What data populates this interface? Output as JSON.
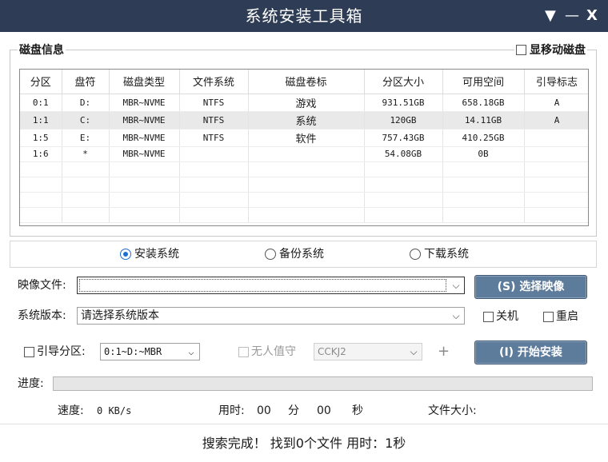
{
  "window": {
    "title": "系统安装工具箱",
    "menu_glyph": "▼",
    "minimize_glyph": "—",
    "close_glyph": "X"
  },
  "disk_group": {
    "title": "磁盘信息",
    "show_removable_label": "显移动磁盘",
    "columns": [
      "分区",
      "盘符",
      "磁盘类型",
      "文件系统",
      "磁盘卷标",
      "分区大小",
      "可用空间",
      "引导标志"
    ],
    "rows": [
      [
        "0:1",
        "D:",
        "MBR~NVME",
        "NTFS",
        "游戏",
        "931.51GB",
        "658.18GB",
        "A"
      ],
      [
        "1:1",
        "C:",
        "MBR~NVME",
        "NTFS",
        "系统",
        "120GB",
        "14.11GB",
        "A"
      ],
      [
        "1:5",
        "E:",
        "MBR~NVME",
        "NTFS",
        "软件",
        "757.43GB",
        "410.25GB",
        ""
      ],
      [
        "1:6",
        "*",
        "MBR~NVME",
        "",
        "",
        "54.08GB",
        "0B",
        ""
      ]
    ]
  },
  "modes": {
    "install": "安装系统",
    "backup": "备份系统",
    "download": "下载系统",
    "selected": "install"
  },
  "image_file": {
    "label": "映像文件:",
    "value": "",
    "button": "(S) 选择映像"
  },
  "version": {
    "label": "系统版本:",
    "value": "请选择系统版本",
    "shutdown": "关机",
    "restart": "重启"
  },
  "boot": {
    "label": "引导分区:",
    "value": "0:1~D:~MBR",
    "unattended": "无人值守",
    "account_value": "CCKJ2",
    "plus": "+",
    "install_button": "(I) 开始安装"
  },
  "progress": {
    "label": "进度:",
    "percent": 0
  },
  "stats": {
    "speed_label": "速度:",
    "speed_value": "0 KB/s",
    "time_label": "用时:",
    "minutes": "00",
    "min_unit": "分",
    "seconds": "00",
    "sec_unit": "秒",
    "size_label": "文件大小:"
  },
  "status": "搜索完成！ 找到0个文件 用时：1秒",
  "colors": {
    "titlebar": "#2e3d55",
    "button": "#5d7c9b",
    "radio_accent": "#1e6fd0"
  }
}
